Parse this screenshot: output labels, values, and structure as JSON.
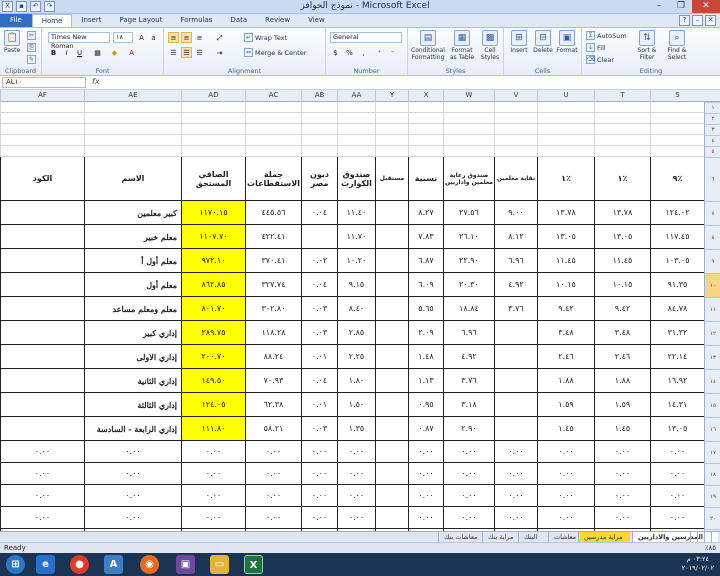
{
  "window": {
    "title": "نموذج الحوافز - Microsoft Excel",
    "quick_access": [
      "save-icon",
      "undo-icon",
      "redo-icon"
    ]
  },
  "tabs": [
    "File",
    "Home",
    "Insert",
    "Page Layout",
    "Formulas",
    "Data",
    "Review",
    "View"
  ],
  "ribbon": {
    "clipboard": {
      "label": "Clipboard",
      "paste": "Paste"
    },
    "font": {
      "label": "Font",
      "font_name": "Times New Roman",
      "font_size": "١٨"
    },
    "alignment": {
      "label": "Alignment",
      "wrap": "Wrap Text",
      "merge": "Merge & Center"
    },
    "number": {
      "label": "Number",
      "format": "General"
    },
    "styles": {
      "label": "Styles",
      "conditional": "Conditional Formatting",
      "format_table": "Format as Table",
      "cell_styles": "Cell Styles"
    },
    "cells": {
      "label": "Cells",
      "insert": "Insert",
      "delete": "Delete",
      "format": "Format"
    },
    "editing": {
      "label": "Editing",
      "autosum": "AutoSum",
      "fill": "Fill",
      "clear": "Clear",
      "sort": "Sort & Filter",
      "find": "Find & Select"
    }
  },
  "formula_bar": {
    "name_box": "AL١٠",
    "fx": "fx"
  },
  "columns": [
    "S",
    "T",
    "U",
    "V",
    "W",
    "X",
    "Y",
    "AA",
    "AB",
    "AC",
    "AD",
    "AE",
    "AF"
  ],
  "row_numbers": [
    "١",
    "٢",
    "٣",
    "٤",
    "٥",
    "٦",
    "٧",
    "٨",
    "٩",
    "١٠",
    "١١",
    "١٢",
    "١٣",
    "١٤",
    "١٥",
    "١٦",
    "١٧",
    "١٨",
    "١٩",
    "٢٠",
    "٢١"
  ],
  "selected_row": "١٠",
  "table": {
    "headers": {
      "S": "٩٪",
      "T": "١٪",
      "U": "١٪",
      "V": "نقابة معلمين",
      "W": "صندوق رعاية معلمين واداريين",
      "X": "نسبية",
      "Y": "مستقبل",
      "AA": "صندوق الكوارث",
      "AB": "ديون مصر",
      "AC": "جملة الاستقطاعات",
      "AD": "الصافي المستحق",
      "AE": "الاسم",
      "AF": "الكود"
    },
    "rows": [
      {
        "S": "١٢٤.٠٢",
        "T": "١٣.٧٨",
        "U": "١٣.٧٨",
        "V": "٩.٠٠",
        "W": "٢٧.٥٦",
        "X": "٨.٢٧",
        "Y": "",
        "AA": "١١.٤٠",
        "AB": "٠.٠٤",
        "AC": "٤٤٥.٥٦",
        "AD": "١١٧٠.١٥",
        "AE": "كبير معلمين",
        "AF": ""
      },
      {
        "S": "١١٧.٤٥",
        "T": "١٣.٠٥",
        "U": "١٣.٠٥",
        "V": "٨.١٢",
        "W": "٢٦.١٠",
        "X": "٧.٨٣",
        "Y": "",
        "AA": "١١.٧٠",
        "AB": "",
        "AC": "٤٢٢.٤١",
        "AD": "١١٠٧.٧٠",
        "AE": "معلم خبير",
        "AF": ""
      },
      {
        "S": "١٠٣.٠٥",
        "T": "١١.٤٥",
        "U": "١١.٤٥",
        "V": "٦.٩٦",
        "W": "٢٢.٩٠",
        "X": "٦.٨٧",
        "Y": "",
        "AA": "١٠.٢٠",
        "AB": "٠.٠٢",
        "AC": "٣٧٠.٤١",
        "AD": "٩٧٢.١٠",
        "AE": "معلم أول أ",
        "AF": ""
      },
      {
        "S": "٩١.٣٥",
        "T": "١٠.١٥",
        "U": "١٠.١٥",
        "V": "٤.٩٢",
        "W": "٢٠.٣٠",
        "X": "٦.٠٩",
        "Y": "",
        "AA": "٩.١٥",
        "AB": "٠.٠٤",
        "AC": "٣٢٧.٧٤",
        "AD": "٨٦٢.٨٥",
        "AE": "معلم أول",
        "AF": ""
      },
      {
        "S": "٨٤.٧٨",
        "T": "٩.٤٢",
        "U": "٩.٤٢",
        "V": "٣.٧٦",
        "W": "١٨.٨٤",
        "X": "٥.٦٥",
        "Y": "",
        "AA": "٨.٤٠",
        "AB": "٠.٠٣",
        "AC": "٣٠٢.٨٠",
        "AD": "٨٠١.٧٠",
        "AE": "معلم ومعلم مساعد",
        "AF": ""
      },
      {
        "S": "٣١.٣٢",
        "T": "٣.٤٨",
        "U": "٣.٤٨",
        "V": "",
        "W": "٦.٩٦",
        "X": "٢.٠٩",
        "Y": "",
        "AA": "٢.٨٥",
        "AB": "٠.٠٣",
        "AC": "١١٨.٢٨",
        "AD": "٢٨٩.٧٥",
        "AE": "إداري كبير",
        "AF": ""
      },
      {
        "S": "٢٢.١٤",
        "T": "٢.٤٦",
        "U": "٢.٤٦",
        "V": "",
        "W": "٤.٩٢",
        "X": "١.٤٨",
        "Y": "",
        "AA": "٢.٢٥",
        "AB": "٠.٠١",
        "AC": "٨٨.٢٤",
        "AD": "٢٠٠.٧٠",
        "AE": "إداري الاولى",
        "AF": ""
      },
      {
        "S": "١٦.٩٢",
        "T": "١.٨٨",
        "U": "١.٨٨",
        "V": "",
        "W": "٣.٧٦",
        "X": "١.١٣",
        "Y": "",
        "AA": "١.٨٠",
        "AB": "٠.٠٤",
        "AC": "٧٠.٩٣",
        "AD": "١٤٩.٥٠",
        "AE": "إداري الثانية",
        "AF": ""
      },
      {
        "S": "١٤.٣١",
        "T": "١.٥٩",
        "U": "١.٥٩",
        "V": "",
        "W": "٣.١٨",
        "X": "٠.٩٥",
        "Y": "",
        "AA": "١.٥٠",
        "AB": "٠.٠١",
        "AC": "٦٢.٣٨",
        "AD": "١٢٤.٠٥",
        "AE": "إداري الثالثة",
        "AF": ""
      },
      {
        "S": "١٣.٠٥",
        "T": "١.٤٥",
        "U": "١.٤٥",
        "V": "",
        "W": "٢.٩٠",
        "X": "٠.٨٧",
        "Y": "",
        "AA": "١.٣٥",
        "AB": "٠.٠٣",
        "AC": "٥٨.٢١",
        "AD": "١١١.٨٠",
        "AE": "إداري الرابعة - السادسة",
        "AF": ""
      }
    ],
    "zero": "٠.٠٠"
  },
  "sheet_tabs": [
    "المدرسين والاداريين",
    "مراية مدرسين",
    "معاشات",
    "البنك",
    "مراية بنك",
    "معاشات بنك"
  ],
  "status": {
    "ready": "Ready",
    "zoom": "٪٨٥"
  },
  "taskbar": {
    "time": "٠٣:٢٤ م",
    "date": "٢٠١٩/٠٢/٠٢"
  }
}
